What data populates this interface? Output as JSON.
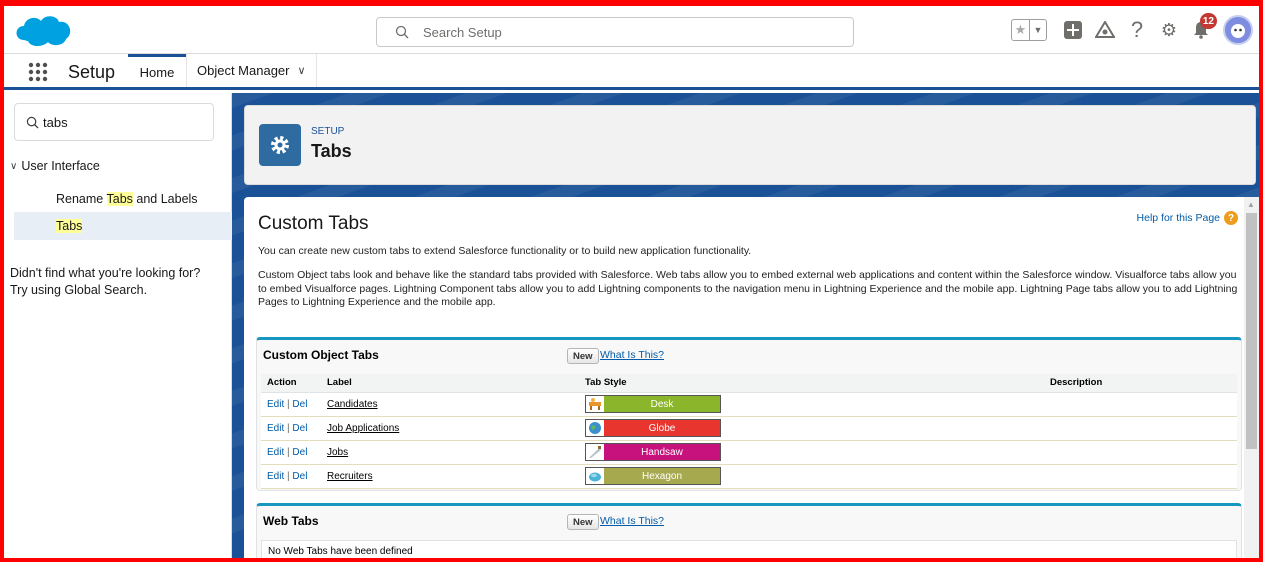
{
  "header": {
    "search_placeholder": "Search Setup",
    "notification_count": "12",
    "icons": [
      "favorites-star-icon",
      "favorites-dropdown-icon",
      "global-actions-add-icon",
      "trailhead-icon",
      "help-icon",
      "setup-gear-icon",
      "notifications-bell-icon",
      "avatar"
    ]
  },
  "context_bar": {
    "app_title": "Setup",
    "tabs": [
      {
        "label": "Home"
      },
      {
        "label": "Object Manager"
      }
    ]
  },
  "sidebar": {
    "quick_find_value": "tabs",
    "tree_section": "User Interface",
    "items": [
      {
        "before": "Rename ",
        "highlight": "Tabs",
        "after": " and Labels"
      },
      {
        "before": "",
        "highlight": "Tabs",
        "after": ""
      }
    ],
    "not_found_line1": "Didn't find what you're looking for?",
    "not_found_line2": "Try using Global Search."
  },
  "page_header": {
    "type": "SETUP",
    "title": "Tabs"
  },
  "content": {
    "title": "Custom Tabs",
    "help_link": "Help for this Page",
    "intro": "You can create new custom tabs to extend Salesforce functionality or to build new application functionality.",
    "description": "Custom Object tabs look and behave like the standard tabs provided with Salesforce. Web tabs allow you to embed external web applications and content within the Salesforce window. Visualforce tabs allow you to embed Visualforce pages. Lightning Component tabs allow you to add Lightning components to the navigation menu in Lightning Experience and the mobile app. Lightning Page tabs allow you to add Lightning Pages to Lightning Experience and the mobile app."
  },
  "custom_object_tabs": {
    "title": "Custom Object Tabs",
    "new_label": "New",
    "what_label": "What Is This?",
    "columns": [
      "Action",
      "Label",
      "Tab Style",
      "Description"
    ],
    "rows": [
      {
        "edit": "Edit",
        "sep": "|",
        "del": "Del",
        "label": "Candidates",
        "style": "Desk",
        "color": "#8bb62b",
        "icon": "desk-icon",
        "description": ""
      },
      {
        "edit": "Edit",
        "sep": "|",
        "del": "Del",
        "label": "Job Applications",
        "style": "Globe",
        "color": "#e8352e",
        "icon": "globe-icon",
        "description": ""
      },
      {
        "edit": "Edit",
        "sep": "|",
        "del": "Del",
        "label": "Jobs",
        "style": "Handsaw",
        "color": "#c7127d",
        "icon": "handsaw-icon",
        "description": ""
      },
      {
        "edit": "Edit",
        "sep": "|",
        "del": "Del",
        "label": "Recruiters",
        "style": "Hexagon",
        "color": "#a7a94f",
        "icon": "hexagon-icon",
        "description": ""
      }
    ]
  },
  "web_tabs": {
    "title": "Web Tabs",
    "new_label": "New",
    "what_label": "What Is This?",
    "empty_text": "No Web Tabs have been defined"
  },
  "colors": {
    "brand_blue": "#1b5297",
    "block_accent": "#1797c0",
    "link": "#015ba7",
    "highlight": "#ffff99",
    "frame": "#ff0000"
  }
}
